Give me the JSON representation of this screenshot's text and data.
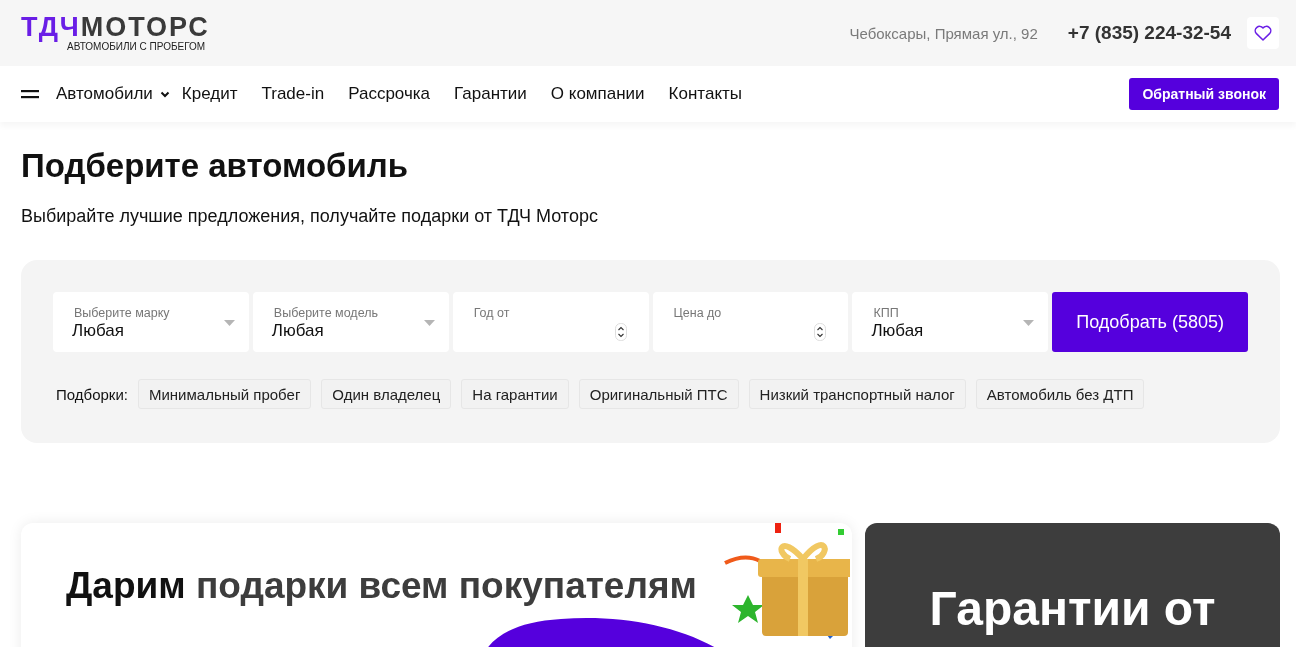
{
  "header": {
    "logo": {
      "part_1": "ТДЧ",
      "part_2": "МОТОРС",
      "tagline": "АВТОМОБИЛИ С ПРОБЕГОМ"
    },
    "address": "Чебоксары, Прямая ул., 92",
    "phone": "+7 (835) 224-32-54"
  },
  "nav": {
    "items": [
      {
        "label": "Автомобили",
        "dropdown": true
      },
      {
        "label": "Кредит",
        "dropdown": false
      },
      {
        "label": "Trade-in",
        "dropdown": false
      },
      {
        "label": "Рассрочка",
        "dropdown": false
      },
      {
        "label": "Гарантии",
        "dropdown": false
      },
      {
        "label": "О компании",
        "dropdown": false
      },
      {
        "label": "Контакты",
        "dropdown": false
      }
    ],
    "callback_button": "Обратный звонок"
  },
  "title": "Подберите автомобиль",
  "subtitle": "Выбирайте лучшие предложения, получайте подарки от ТДЧ Моторс",
  "filter": {
    "fields": [
      {
        "kind": "select",
        "label": "Выберите марку",
        "value": "Любая"
      },
      {
        "kind": "select",
        "label": "Выберите модель",
        "value": "Любая"
      },
      {
        "kind": "number",
        "label": "Год от"
      },
      {
        "kind": "number",
        "label": "Цена до"
      },
      {
        "kind": "select",
        "label": "КПП",
        "value": "Любая"
      }
    ],
    "submit_button": "Подобрать (5805)",
    "collections_label": "Подборки:",
    "collections": [
      "Минимальный пробег",
      "Один владелец",
      "На гарантии",
      "Оригинальный ПТС",
      "Низкий транспортный налог",
      "Автомобиль без ДТП"
    ]
  },
  "promo_cards": [
    {
      "kind": "gift",
      "heading_lead": "Дарим",
      "heading_rest": "подарки всем покупателям"
    },
    {
      "kind": "dark",
      "heading": "Гарантии от"
    }
  ]
}
